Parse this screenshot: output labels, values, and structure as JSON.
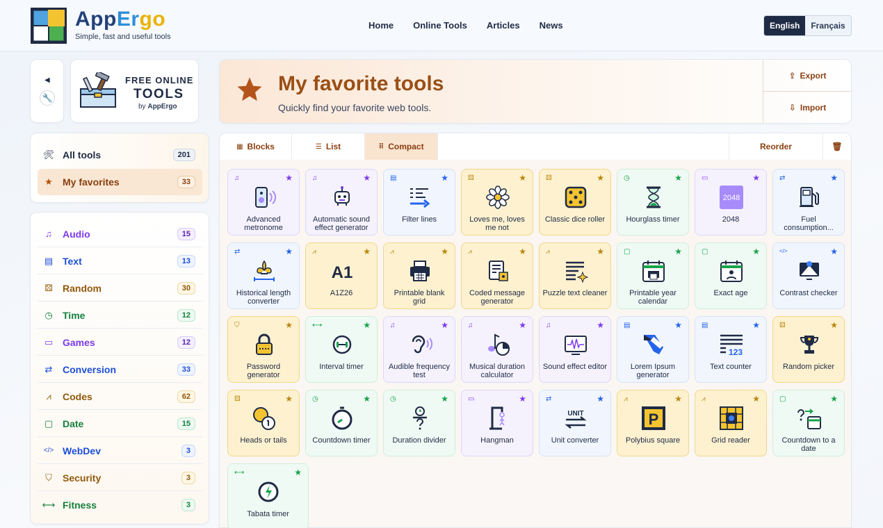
{
  "brand": {
    "name_a": "App",
    "name_b": "Er",
    "name_c": "go",
    "tagline": "Simple, fast and useful tools"
  },
  "nav": {
    "home": "Home",
    "online_tools": "Online Tools",
    "articles": "Articles",
    "news": "News"
  },
  "lang": {
    "en": "English",
    "fr": "Français"
  },
  "promo": {
    "line1": "FREE ONLINE",
    "line2": "TOOLS",
    "line3_by": "by ",
    "line3_brand": "AppErgo"
  },
  "main_cats": [
    {
      "label": "All tools",
      "count": "201",
      "icon": "tools-icon"
    },
    {
      "label": "My favorites",
      "count": "33",
      "icon": "star-icon"
    }
  ],
  "categories": [
    {
      "label": "Audio",
      "count": "15",
      "icon": "music-icon",
      "color": "#7c3aed"
    },
    {
      "label": "Text",
      "count": "13",
      "icon": "document-icon",
      "color": "#1d4ed8"
    },
    {
      "label": "Random",
      "count": "30",
      "icon": "random-icon",
      "color": "#92580a"
    },
    {
      "label": "Time",
      "count": "12",
      "icon": "clock-icon",
      "color": "#15803d"
    },
    {
      "label": "Games",
      "count": "12",
      "icon": "gamepad-icon",
      "color": "#7c3aed"
    },
    {
      "label": "Conversion",
      "count": "33",
      "icon": "swap-icon",
      "color": "#1d4ed8"
    },
    {
      "label": "Codes",
      "count": "62",
      "icon": "codes-icon",
      "color": "#92580a"
    },
    {
      "label": "Date",
      "count": "15",
      "icon": "calendar-icon",
      "color": "#15803d"
    },
    {
      "label": "WebDev",
      "count": "3",
      "icon": "code-icon",
      "color": "#1d4ed8"
    },
    {
      "label": "Security",
      "count": "3",
      "icon": "shield-icon",
      "color": "#92580a"
    },
    {
      "label": "Fitness",
      "count": "3",
      "icon": "dumbbell-icon",
      "color": "#15803d"
    }
  ],
  "banner": {
    "title": "My favorite tools",
    "subtitle": "Quickly find your favorite web tools.",
    "export": "Export",
    "import": "Import"
  },
  "toolbar": {
    "blocks": "Blocks",
    "list": "List",
    "compact": "Compact",
    "reorder": "Reorder"
  },
  "tiles": [
    {
      "name": "Advanced metronome",
      "cat": "audio"
    },
    {
      "name": "Automatic sound effect generator",
      "cat": "audio"
    },
    {
      "name": "Filter lines",
      "cat": "text"
    },
    {
      "name": "Loves me, loves me not",
      "cat": "random"
    },
    {
      "name": "Classic dice roller",
      "cat": "random"
    },
    {
      "name": "Hourglass timer",
      "cat": "time"
    },
    {
      "name": "2048",
      "cat": "games"
    },
    {
      "name": "Fuel consumption...",
      "cat": "conversion"
    },
    {
      "name": "Historical length converter",
      "cat": "conversion"
    },
    {
      "name": "A1Z26",
      "cat": "codes"
    },
    {
      "name": "Printable blank grid",
      "cat": "codes"
    },
    {
      "name": "Coded message generator",
      "cat": "codes"
    },
    {
      "name": "Puzzle text cleaner",
      "cat": "codes"
    },
    {
      "name": "Printable year calendar",
      "cat": "date"
    },
    {
      "name": "Exact age",
      "cat": "date"
    },
    {
      "name": "Contrast checker",
      "cat": "webdev"
    },
    {
      "name": "Password generator",
      "cat": "security"
    },
    {
      "name": "Interval timer",
      "cat": "fitness"
    },
    {
      "name": "Audible frequency test",
      "cat": "audio"
    },
    {
      "name": "Musical duration calculator",
      "cat": "audio"
    },
    {
      "name": "Sound effect editor",
      "cat": "audio"
    },
    {
      "name": "Lorem Ipsum generator",
      "cat": "text"
    },
    {
      "name": "Text counter",
      "cat": "text"
    },
    {
      "name": "Random picker",
      "cat": "random"
    },
    {
      "name": "Heads or tails",
      "cat": "random"
    },
    {
      "name": "Countdown timer",
      "cat": "time"
    },
    {
      "name": "Duration divider",
      "cat": "time"
    },
    {
      "name": "Hangman",
      "cat": "games"
    },
    {
      "name": "Unit converter",
      "cat": "conversion"
    },
    {
      "name": "Polybius square",
      "cat": "codes"
    },
    {
      "name": "Grid reader",
      "cat": "codes"
    },
    {
      "name": "Countdown to a date",
      "cat": "date"
    },
    {
      "name": "Tabata timer",
      "cat": "fitness"
    }
  ],
  "tile_art_texts": {
    "a1z26": "A1",
    "g2048": "2048",
    "unit": "UNIT",
    "polybius": "P",
    "n123": "123"
  }
}
